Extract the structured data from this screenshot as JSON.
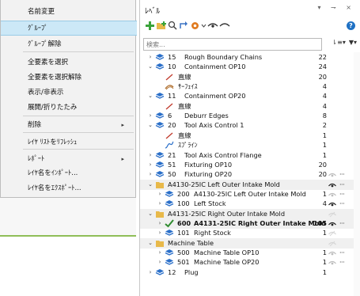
{
  "context_menu": {
    "items": [
      {
        "label": "名前変更",
        "submenu": false
      },
      {
        "label": "ｸﾞﾙｰﾌﾟ",
        "submenu": false,
        "highlight": true
      },
      {
        "label": "ｸﾞﾙｰﾌﾟ解除",
        "submenu": false
      },
      {
        "label": "全要素を選択",
        "submenu": false
      },
      {
        "label": "全要素を選択解除",
        "submenu": false
      },
      {
        "label": "表示/非表示",
        "submenu": false
      },
      {
        "label": "展開/折りたたみ",
        "submenu": false
      },
      {
        "label": "削除",
        "submenu": true
      },
      {
        "label": "ﾚｲﾔ ﾘｽﾄをﾘﾌﾚｯｼｭ",
        "submenu": false
      },
      {
        "label": "ﾚﾎﾟｰﾄ",
        "submenu": true
      },
      {
        "label": "ﾚｲﾔ名をｲﾝﾎﾟｰﾄ...",
        "submenu": false
      },
      {
        "label": "ﾚｲﾔ名をｴｸｽﾎﾟｰﾄ...",
        "submenu": false
      }
    ],
    "submenu_arrow": "▸"
  },
  "panel": {
    "title": "ﾚﾍﾞﾙ",
    "title_buttons": "▾ ⇁ ×",
    "search_placeholder": "検索...",
    "help_label": "?",
    "search_buttons": [
      "⇂≡▾",
      "▼▾"
    ]
  },
  "colors": {
    "highlight": "#cce8f7",
    "level_icon": "#2a6fc9",
    "folder": "#e8b94a",
    "check": "#2e8b2e",
    "toolbar_plus": "#3aa33a"
  },
  "tree": [
    {
      "indent": 0,
      "chev": "›",
      "icon": "level-icon",
      "num": "15",
      "name": "Rough Boundary Chains",
      "count": "22"
    },
    {
      "indent": 0,
      "chev": "⌄",
      "icon": "level-icon",
      "num": "10",
      "name": "Containment OP10",
      "count": "24"
    },
    {
      "indent": 1,
      "chev": "",
      "icon": "line-icon",
      "num": "",
      "name": "直線",
      "count": "20"
    },
    {
      "indent": 1,
      "chev": "",
      "icon": "surface-icon",
      "num": "",
      "name": "ｻｰﾌｪｲｽ",
      "count": "4"
    },
    {
      "indent": 0,
      "chev": "⌄",
      "icon": "level-icon",
      "num": "11",
      "name": "Containment OP20",
      "count": "4"
    },
    {
      "indent": 1,
      "chev": "",
      "icon": "line-icon",
      "num": "",
      "name": "直線",
      "count": "4"
    },
    {
      "indent": 0,
      "chev": "›",
      "icon": "level-icon",
      "num": "6",
      "name": "Deburr Edges",
      "count": "8"
    },
    {
      "indent": 0,
      "chev": "⌄",
      "icon": "level-icon",
      "num": "20",
      "name": "Tool Axis Control 1",
      "count": "2"
    },
    {
      "indent": 1,
      "chev": "",
      "icon": "line-icon",
      "num": "",
      "name": "直線",
      "count": "1"
    },
    {
      "indent": 1,
      "chev": "",
      "icon": "spline-icon",
      "num": "",
      "name": "ｽﾌﾟﾗｲﾝ",
      "count": "1"
    },
    {
      "indent": 0,
      "chev": "›",
      "icon": "level-icon",
      "num": "21",
      "name": "Tool Axis Control Flange",
      "count": "1"
    },
    {
      "indent": 0,
      "chev": "›",
      "icon": "level-icon",
      "num": "51",
      "name": "Fixturing OP10",
      "count": "20"
    },
    {
      "indent": 0,
      "chev": "›",
      "icon": "level-icon",
      "num": "50",
      "name": "Fixturing OP20",
      "count": "20",
      "eye": "dim",
      "more": "···"
    },
    {
      "indent": 0,
      "chev": "⌄",
      "icon": "folder-icon",
      "num": "",
      "name": "A4130-25IC Left Outer Intake Mold",
      "count": "",
      "group": true,
      "eye": "open",
      "more": "···"
    },
    {
      "indent": 1,
      "chev": "›",
      "icon": "level-icon",
      "num": "200",
      "name": "A4130-25IC Left Outer Intake Mold",
      "count": "1",
      "eye": "dim",
      "more": "···"
    },
    {
      "indent": 1,
      "chev": "›",
      "icon": "level-icon",
      "num": "100",
      "name": "Left Stock",
      "count": "4",
      "eye": "open",
      "more": "···"
    },
    {
      "indent": 0,
      "chev": "⌄",
      "icon": "folder-icon",
      "num": "",
      "name": "A4131-25IC Right Outer Intake Mold",
      "count": "",
      "group": true,
      "eye": "faded"
    },
    {
      "indent": 1,
      "chev": "›",
      "icon": "check-icon",
      "num": "600",
      "name": "A4131-25IC Right Outer Intake Mold",
      "count": "105",
      "bold": true,
      "selected": true,
      "eye": "open",
      "more": "···"
    },
    {
      "indent": 1,
      "chev": "›",
      "icon": "level-icon",
      "num": "101",
      "name": "Right Stock",
      "count": "1",
      "eye": "faded"
    },
    {
      "indent": 0,
      "chev": "⌄",
      "icon": "folder-icon",
      "num": "",
      "name": "Machine Table",
      "count": "",
      "group": true,
      "eye": "faded"
    },
    {
      "indent": 1,
      "chev": "›",
      "icon": "level-icon",
      "num": "500",
      "name": "Machine Table OP10",
      "count": "1",
      "eye": "dim",
      "more": "···"
    },
    {
      "indent": 1,
      "chev": "›",
      "icon": "level-icon",
      "num": "501",
      "name": "Machine Table OP20",
      "count": "1",
      "eye": "dim",
      "more": "···"
    },
    {
      "indent": 0,
      "chev": "›",
      "icon": "level-icon",
      "num": "12",
      "name": "Plug",
      "count": "1"
    }
  ]
}
